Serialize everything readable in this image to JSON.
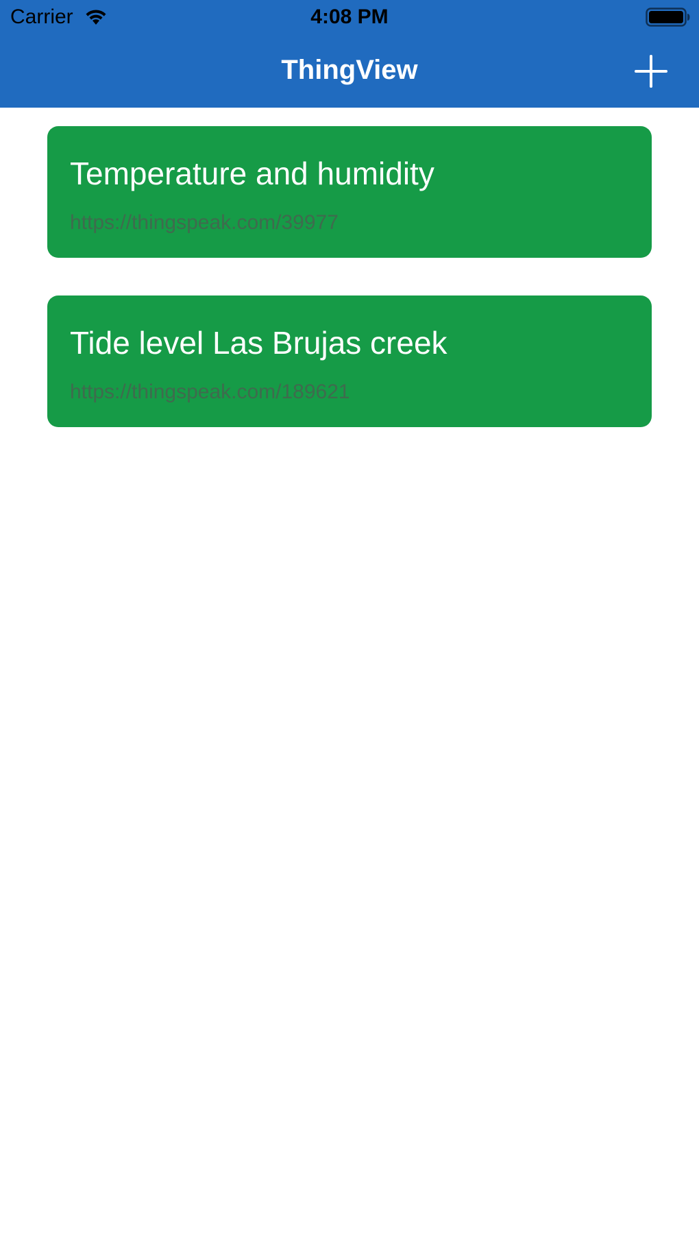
{
  "status_bar": {
    "carrier": "Carrier",
    "time": "4:08 PM",
    "icons": [
      "wifi-icon",
      "battery-icon"
    ]
  },
  "nav_bar": {
    "title": "ThingView",
    "add_icon": "plus-icon"
  },
  "channels": [
    {
      "title": "Temperature and humidity",
      "url": "https://thingspeak.com/39977"
    },
    {
      "title": "Tide level Las Brujas creek",
      "url": "https://thingspeak.com/189621"
    }
  ],
  "colors": {
    "nav_background": "#206bbf",
    "card_background": "#169b47",
    "card_title": "#ffffff",
    "card_url": "#3f6b4e"
  }
}
